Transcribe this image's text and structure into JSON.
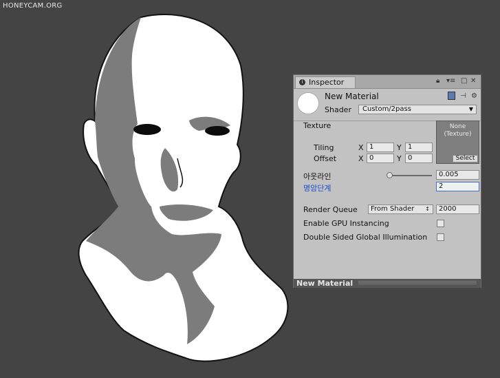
{
  "watermark": "HONEYCAM.ORG",
  "inspector": {
    "tab_label": "Inspector",
    "material_name": "New Material",
    "shader_label": "Shader",
    "shader_value": "Custom/2pass",
    "texture": {
      "label": "Texture",
      "slot_text": "None\n(Texture)",
      "select_label": "Select",
      "tiling_label": "Tiling",
      "offset_label": "Offset",
      "x_label": "X",
      "y_label": "Y",
      "tiling_x": "1",
      "tiling_y": "1",
      "offset_x": "0",
      "offset_y": "0"
    },
    "outline": {
      "label": "아웃라인",
      "value": "0.005",
      "slider_fraction": 0.03
    },
    "shade_steps": {
      "label": "명암단계",
      "value": "2"
    },
    "render_queue": {
      "label": "Render Queue",
      "mode": "From Shader",
      "value": "2000"
    },
    "gpu_instancing": {
      "label": "Enable GPU Instancing",
      "checked": false
    },
    "double_sided_gi": {
      "label": "Double Sided Global Illumination",
      "checked": false
    },
    "footer_label": "New Material"
  },
  "colors": {
    "background": "#444444",
    "face_light": "#ffffff",
    "face_shadow": "#7c7c7c",
    "outline": "#111111"
  }
}
